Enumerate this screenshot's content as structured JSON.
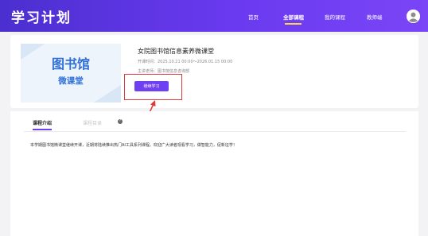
{
  "header": {
    "brand": "学习计划",
    "nav": [
      "首页",
      "全部课程",
      "我的课程",
      "教师端"
    ],
    "active_nav": "全部课程"
  },
  "course": {
    "cover_title": "图书馆",
    "cover_subtitle": "微课堂",
    "title": "女院图书馆信息素养微课堂",
    "dates": "开课时间：2025.10.21 00:00～2026.01.15 00:00",
    "organizer": "主讲老师：图书馆信息咨询部",
    "start_button": "继续学习"
  },
  "tabs": [
    "课程介绍",
    "课程目录"
  ],
  "active_tab": "课程介绍",
  "description": "本学期图书馆微课堂继续开课，近期将陆续推出热门AI工具系列课程。欢迎广大读者观看学习，做智能力，促新征学！",
  "colors": {
    "header_start": "#4b2fcf",
    "header_end": "#7a45f6",
    "accent": "#6f3ff2",
    "highlight": "#e0393c",
    "nav_underline": "#ffd54a"
  }
}
